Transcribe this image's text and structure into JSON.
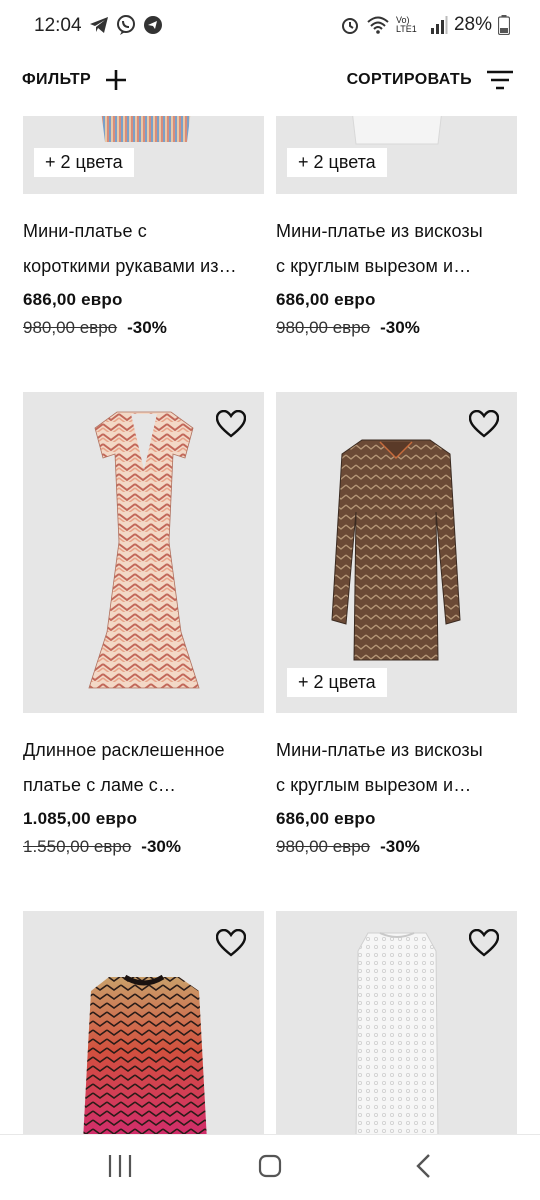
{
  "status": {
    "time": "12:04",
    "battery": "28%",
    "network": "Vo) LTE1"
  },
  "toolbar": {
    "filter_label": "ФИЛЬТР",
    "sort_label": "СОРТИРОВАТЬ"
  },
  "products": [
    {
      "title_line1": "Мини-платье с",
      "title_line2": "короткими рукавами из…",
      "price": "686,00 евро",
      "old_price": "980,00 евро",
      "discount": "-30%",
      "colors_tag": "+ 2 цвета"
    },
    {
      "title_line1": "Мини-платье из вискозы",
      "title_line2": "с круглым вырезом и…",
      "price": "686,00 евро",
      "old_price": "980,00 евро",
      "discount": "-30%",
      "colors_tag": "+ 2 цвета"
    },
    {
      "title_line1": "Длинное расклешенное",
      "title_line2": "платье с ламе с…",
      "price": "1.085,00 евро",
      "old_price": "1.550,00 евро",
      "discount": "-30%"
    },
    {
      "title_line1": "Мини-платье из вискозы",
      "title_line2": "с круглым вырезом и…",
      "price": "686,00 евро",
      "old_price": "980,00 евро",
      "discount": "-30%",
      "colors_tag": "+ 2 цвета"
    },
    {},
    {}
  ],
  "colors": {
    "tile_background": "#e6e6e6",
    "text": "#111111"
  }
}
